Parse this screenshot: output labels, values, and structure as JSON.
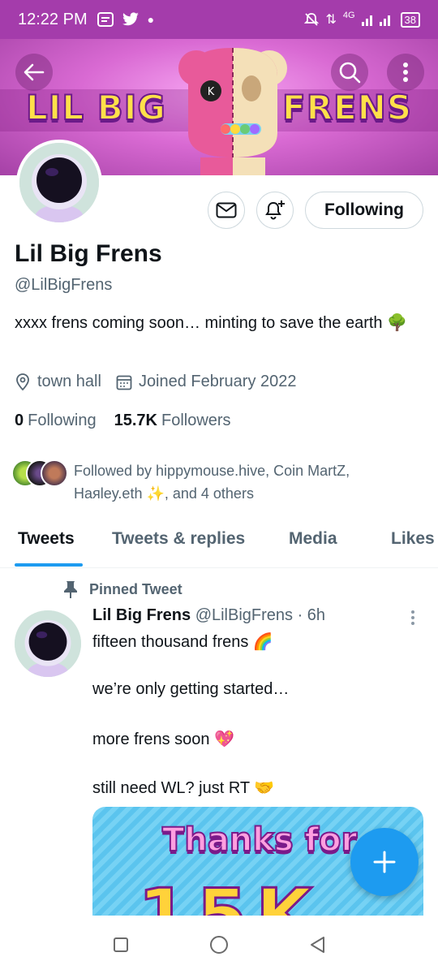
{
  "status_bar": {
    "time": "12:22 PM",
    "network": "4G",
    "battery": "38"
  },
  "banner": {
    "title_left": "LIL BIG",
    "title_right": "FRENS"
  },
  "profile": {
    "name": "Lil Big Frens",
    "handle": "@LilBigFrens",
    "bio": "xxxx frens coming soon…   minting to save the earth 🌳",
    "location": "town hall",
    "joined": "Joined February 2022",
    "following_count": "0",
    "following_label": "Following",
    "followers_count": "15.7K",
    "followers_label": "Followers",
    "follow_button": "Following",
    "followed_by": "Followed by hippymouse.hive, Coin MartZ, Haяley.eth ✨, and 4 others"
  },
  "tabs": [
    {
      "label": "Tweets",
      "active": true
    },
    {
      "label": "Tweets & replies",
      "active": false
    },
    {
      "label": "Media",
      "active": false
    },
    {
      "label": "Likes",
      "active": false
    }
  ],
  "pinned_tweet": {
    "pinned_label": "Pinned Tweet",
    "author_name": "Lil Big Frens",
    "author_handle": "@LilBigFrens",
    "time": "· 6h",
    "lines": [
      "fifteen thousand frens 🌈",
      "we’re only getting started…",
      "more frens soon 💖",
      "still need WL? just RT 🤝"
    ],
    "media_text": "Thanks for",
    "media_big": "15K"
  },
  "colors": {
    "accent": "#1d9bf0",
    "status_bar": "#a43cab",
    "text_secondary": "#536471"
  },
  "icons": [
    "back-arrow-icon",
    "search-icon",
    "more-vertical-icon",
    "mail-icon",
    "bell-plus-icon",
    "location-pin-icon",
    "calendar-icon",
    "pin-icon",
    "compose-plus-icon",
    "nav-square-icon",
    "nav-circle-icon",
    "nav-back-triangle-icon"
  ]
}
